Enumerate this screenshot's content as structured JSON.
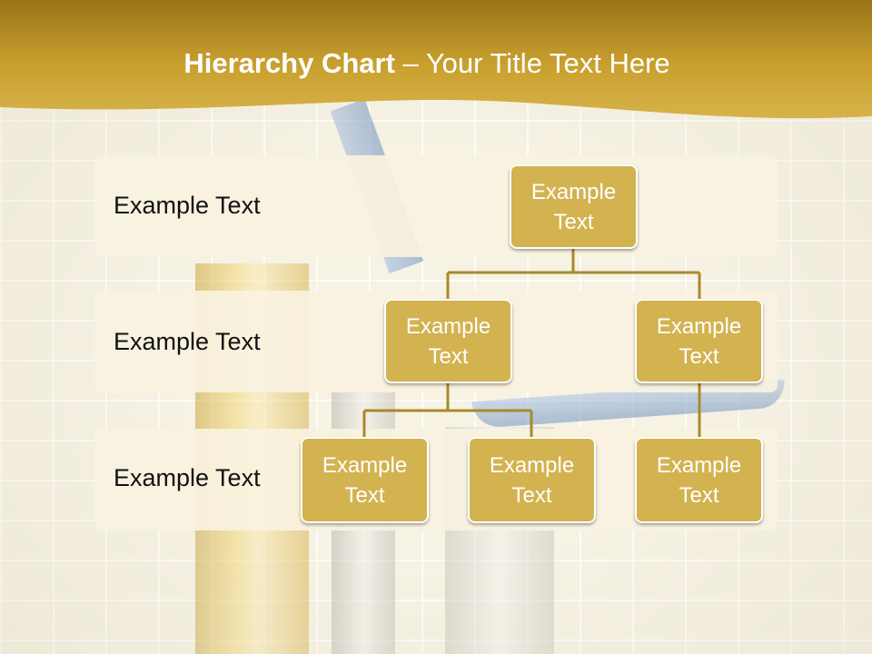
{
  "title": {
    "bold": "Hierarchy Chart",
    "rest": " – Your Title Text Here"
  },
  "levels": [
    {
      "label": "Example Text"
    },
    {
      "label": "Example Text"
    },
    {
      "label": "Example Text"
    }
  ],
  "nodes": {
    "root": "Example Text",
    "l2_left": "Example Text",
    "l2_right": "Example Text",
    "l3_1": "Example Text",
    "l3_2": "Example Text",
    "l3_3": "Example Text"
  },
  "colors": {
    "header_gold": "#c69a25",
    "node_fill": "#d3b250",
    "connector": "#a98a2a",
    "band": "#f9f2e0"
  }
}
